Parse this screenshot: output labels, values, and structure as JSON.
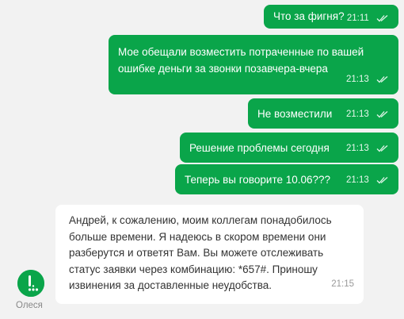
{
  "messages_out": [
    {
      "text": "Что за фигня?",
      "time": "21:11"
    },
    {
      "text": "Мое обещали возместить потраченные по вашей ошибке деньги за звонки позавчера-вчера",
      "time": "21:13"
    },
    {
      "text": "Не возместили",
      "time": "21:13"
    },
    {
      "text": "Решение проблемы сегодня",
      "time": "21:13"
    },
    {
      "text": "Теперь вы говорите 10.06???",
      "time": "21:13"
    }
  ],
  "message_in": {
    "text": "Андрей, к сожалению, моим коллегам понадобилось больше времени. Я надеюсь в скором времени они разберутся и ответят Вам. Вы можете отслеживать статус заявки через комбинацию: *657#. Приношу извинения за доставленные неудобства.",
    "time": "21:15",
    "sender": "Олеся"
  },
  "colors": {
    "outgoing_bubble": "#0aa54a",
    "incoming_bubble": "#ffffff",
    "background": "#f2f2f2"
  },
  "icons": {
    "read_status": "double-check-icon",
    "avatar": "operator-logo-icon"
  }
}
